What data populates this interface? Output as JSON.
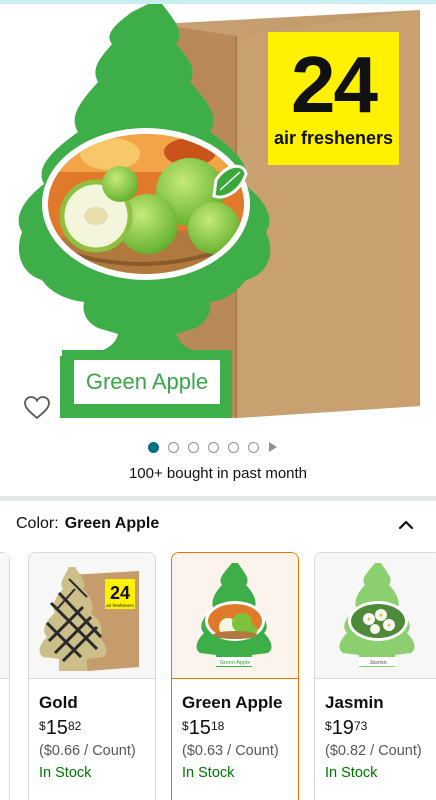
{
  "hero": {
    "badge_number": "24",
    "badge_text": "air fresheners",
    "tree_label": "Green Apple",
    "carousel": {
      "image_count": 6,
      "active_index": 0,
      "has_video": true
    }
  },
  "social_proof": "100+ bought in past month",
  "color_selector": {
    "label": "Color:",
    "selected": "Green Apple"
  },
  "variants": [
    {
      "name": "Gold",
      "currency": "$",
      "price_whole": "15",
      "price_fraction": "82",
      "unit_price": "($0.66 / Count)",
      "availability": "In Stock",
      "selected": false,
      "thumb_badge": "24",
      "thumb_badge_text": "air fresheners"
    },
    {
      "name": "Green Apple",
      "currency": "$",
      "price_whole": "15",
      "price_fraction": "18",
      "unit_price": "($0.63 / Count)",
      "availability": "In Stock",
      "selected": true,
      "thumb_label": "Green Apple"
    },
    {
      "name": "Jasmin",
      "currency": "$",
      "price_whole": "19",
      "price_fraction": "73",
      "unit_price": "($0.82 / Count)",
      "availability": "In Stock",
      "selected": false,
      "thumb_label": "Jasmin"
    }
  ],
  "colors": {
    "tree_green": "#3dae48",
    "cardboard": "#c69c6d",
    "badge_yellow": "#fff200",
    "selected_border": "#e77600",
    "link_teal": "#007185",
    "in_stock_green": "#007600"
  }
}
